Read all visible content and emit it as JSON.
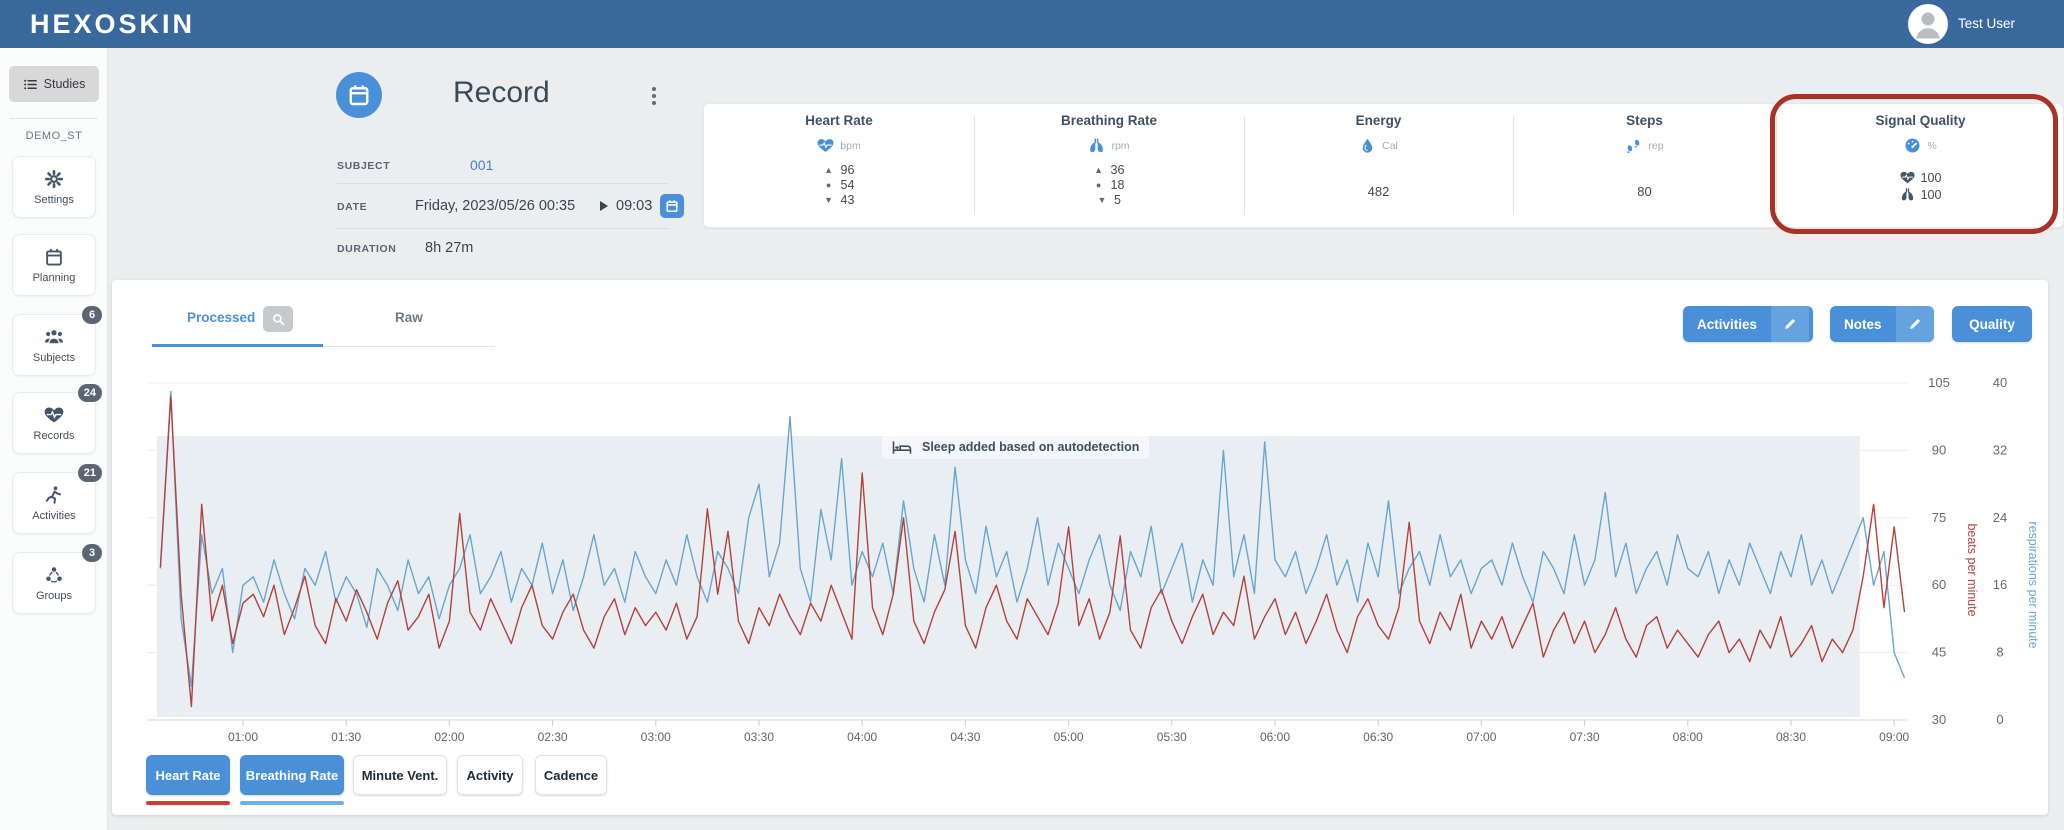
{
  "colors": {
    "navbar_blue": "#39689d",
    "accent_blue": "#4a90d9",
    "hr_red": "#b5413c",
    "br_blue": "#68a6cf",
    "highlight_red": "#a93226",
    "sleep_band": "#e9eef3",
    "badge_gray": "#5b6673"
  },
  "navbar": {
    "logo": "HEXOSKIN",
    "user": "Test User"
  },
  "sidebar": {
    "studies_label": "Studies",
    "study_code": "DEMO_ST",
    "items": [
      {
        "label": "Settings"
      },
      {
        "label": "Planning"
      },
      {
        "label": "Subjects",
        "badge": "6"
      },
      {
        "label": "Records",
        "badge": "24"
      },
      {
        "label": "Activities",
        "badge": "21"
      },
      {
        "label": "Groups",
        "badge": "3"
      }
    ]
  },
  "record": {
    "title": "Record",
    "subject_label": "SUBJECT",
    "subject_value": "001",
    "date_label": "DATE",
    "date_start": "Friday, 2023/05/26 00:35",
    "date_end": "09:03",
    "duration_label": "DURATION",
    "duration_value": "8h 27m"
  },
  "stats": {
    "cards": [
      {
        "title": "Heart Rate",
        "unit": "bpm",
        "max": "96",
        "avg": "54",
        "min": "43"
      },
      {
        "title": "Breathing Rate",
        "unit": "rpm",
        "max": "36",
        "avg": "18",
        "min": "5"
      },
      {
        "title": "Energy",
        "unit": "Cal",
        "value": "482"
      },
      {
        "title": "Steps",
        "unit": "rep",
        "value": "80"
      },
      {
        "title": "Signal Quality",
        "unit": "%",
        "hr_quality": "100",
        "br_quality": "100"
      }
    ]
  },
  "panel": {
    "tabs": [
      {
        "label": "Processed"
      },
      {
        "label": "Raw"
      }
    ],
    "buttons": [
      {
        "label": "Activities"
      },
      {
        "label": "Notes"
      },
      {
        "label": "Quality"
      }
    ],
    "series_buttons": [
      {
        "label": "Heart Rate"
      },
      {
        "label": "Breathing Rate"
      },
      {
        "label": "Minute Vent."
      },
      {
        "label": "Activity"
      },
      {
        "label": "Cadence"
      }
    ]
  },
  "chart_data": {
    "type": "line",
    "title": "",
    "x_axis": {
      "unit": "time of day",
      "range_minutes": [
        35,
        545
      ],
      "tick_minutes": [
        60,
        90,
        120,
        150,
        180,
        210,
        240,
        270,
        300,
        330,
        360,
        390,
        420,
        450,
        480,
        510,
        540
      ],
      "tick_labels": [
        "01:00",
        "01:30",
        "02:00",
        "02:30",
        "03:00",
        "03:30",
        "04:00",
        "04:30",
        "05:00",
        "05:30",
        "06:00",
        "06:30",
        "07:00",
        "07:30",
        "08:00",
        "08:30",
        "09:00"
      ]
    },
    "y_axis_left": {
      "label": "beats per minute",
      "color": "#b5413c",
      "ticks": [
        105,
        90,
        75,
        60,
        45,
        30
      ],
      "range": [
        30,
        105
      ]
    },
    "y_axis_right": {
      "label": "respirations per minute",
      "color": "#68a6cf",
      "ticks": [
        40,
        32,
        24,
        16,
        8,
        0
      ],
      "range": [
        0,
        40
      ]
    },
    "annotation": {
      "icon": "bed",
      "text": "Sleep added based on autodetection"
    },
    "sleep_region_minutes": [
      35,
      530
    ],
    "start_minute": 36,
    "sample_step_minutes": 3,
    "series": [
      {
        "name": "Heart Rate",
        "axis": "left",
        "color": "#b5413c",
        "values": [
          64,
          102,
          58,
          33,
          78,
          52,
          60,
          47,
          56,
          58,
          53,
          60,
          49,
          55,
          62,
          51,
          47,
          57,
          52,
          59,
          54,
          48,
          56,
          61,
          50,
          53,
          58,
          46,
          52,
          76,
          54,
          50,
          57,
          52,
          47,
          55,
          60,
          51,
          48,
          54,
          58,
          50,
          46,
          53,
          57,
          49,
          55,
          51,
          54,
          50,
          56,
          48,
          53,
          77,
          58,
          72,
          52,
          47,
          55,
          51,
          58,
          53,
          49,
          56,
          52,
          60,
          54,
          48,
          85,
          55,
          49,
          58,
          75,
          52,
          47,
          54,
          59,
          72,
          51,
          46,
          55,
          60,
          52,
          48,
          57,
          53,
          49,
          56,
          73,
          51,
          57,
          48,
          54,
          71,
          50,
          46,
          55,
          59,
          52,
          47,
          53,
          58,
          49,
          54,
          51,
          62,
          48,
          53,
          57,
          49,
          54,
          47,
          52,
          58,
          50,
          45,
          53,
          57,
          51,
          48,
          55,
          74,
          52,
          47,
          54,
          50,
          58,
          46,
          52,
          48,
          53,
          46,
          51,
          56,
          44,
          50,
          54,
          47,
          52,
          45,
          49,
          55,
          48,
          44,
          51,
          53,
          46,
          50,
          47,
          44,
          49,
          52,
          45,
          48,
          43,
          50,
          46,
          53,
          44,
          47,
          51,
          43,
          48,
          45,
          50,
          62,
          78,
          55,
          73,
          54
        ]
      },
      {
        "name": "Breathing Rate",
        "axis": "right",
        "color": "#68a6cf",
        "values": [
          18,
          39,
          12,
          4,
          22,
          15,
          18,
          8,
          16,
          17,
          14,
          19,
          15,
          12,
          18,
          16,
          20,
          14,
          17,
          15,
          11,
          18,
          16,
          13,
          19,
          15,
          17,
          12,
          16,
          18,
          22,
          15,
          17,
          20,
          14,
          18,
          16,
          21,
          15,
          19,
          13,
          17,
          22,
          16,
          18,
          14,
          20,
          17,
          15,
          19,
          16,
          22,
          17,
          14,
          20,
          18,
          15,
          24,
          28,
          17,
          21,
          36,
          18,
          14,
          25,
          19,
          31,
          16,
          20,
          17,
          21,
          15,
          26,
          18,
          14,
          22,
          16,
          30,
          19,
          15,
          23,
          17,
          20,
          14,
          18,
          24,
          16,
          21,
          18,
          15,
          19,
          22,
          16,
          13,
          20,
          17,
          23,
          15,
          18,
          21,
          14,
          19,
          16,
          32,
          17,
          22,
          15,
          33,
          19,
          17,
          20,
          15,
          18,
          22,
          16,
          19,
          14,
          21,
          17,
          26,
          15,
          18,
          20,
          16,
          22,
          17,
          19,
          15,
          18,
          19,
          16,
          21,
          17,
          14,
          20,
          18,
          15,
          22,
          16,
          19,
          27,
          17,
          21,
          15,
          18,
          20,
          16,
          22,
          18,
          17,
          20,
          15,
          19,
          16,
          21,
          18,
          15,
          20,
          17,
          22,
          16,
          19,
          15,
          18,
          21,
          24,
          16,
          20,
          8,
          5
        ]
      }
    ]
  }
}
